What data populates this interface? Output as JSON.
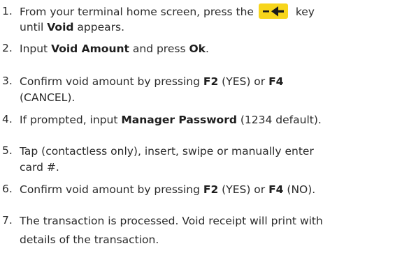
{
  "steps": [
    {
      "number": "1.",
      "line1": {
        "before": "From your terminal home screen, press the",
        "after": "key"
      },
      "line2": {
        "before": "until ",
        "bold": "Void",
        "after": " appears."
      },
      "key_icon": "back-arrow-key-icon",
      "key_color": "#f7d51b"
    },
    {
      "number": "2.",
      "parts": [
        {
          "text": "Input ",
          "bold": false
        },
        {
          "text": "Void Amount",
          "bold": true
        },
        {
          "text": " and press ",
          "bold": false
        },
        {
          "text": "Ok",
          "bold": true
        },
        {
          "text": ".",
          "bold": false
        }
      ]
    },
    {
      "number": "3.",
      "line1": [
        {
          "text": "Confirm void amount by pressing ",
          "bold": false
        },
        {
          "text": "F2",
          "bold": true
        },
        {
          "text": " (YES) or ",
          "bold": false
        },
        {
          "text": "F4",
          "bold": true
        }
      ],
      "line2": "(CANCEL)."
    },
    {
      "number": "4.",
      "parts": [
        {
          "text": "If prompted, input ",
          "bold": false
        },
        {
          "text": "Manager Password",
          "bold": true
        },
        {
          "text": " (1234 default).",
          "bold": false
        }
      ]
    },
    {
      "number": "5.",
      "line1": "Tap (contactless only), insert, swipe or manually enter",
      "line2": "card #."
    },
    {
      "number": "6.",
      "parts": [
        {
          "text": "Confirm void amount by pressing ",
          "bold": false
        },
        {
          "text": "F2",
          "bold": true
        },
        {
          "text": " (YES) or ",
          "bold": false
        },
        {
          "text": "F4",
          "bold": true
        },
        {
          "text": " (NO).",
          "bold": false
        }
      ]
    },
    {
      "number": "7.",
      "line1": "The transaction is processed. Void receipt will print with",
      "line2": "details of the transaction."
    }
  ]
}
